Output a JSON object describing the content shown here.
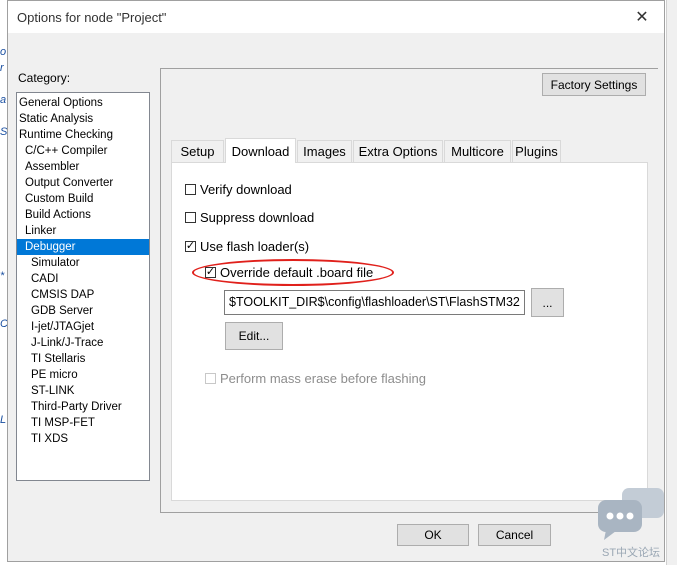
{
  "window": {
    "title": "Options for node \"Project\""
  },
  "category": {
    "label": "Category:",
    "items": [
      "General Options",
      "Static Analysis",
      "Runtime Checking",
      "C/C++ Compiler",
      "Assembler",
      "Output Converter",
      "Custom Build",
      "Build Actions",
      "Linker",
      "Debugger",
      "Simulator",
      "CADI",
      "CMSIS DAP",
      "GDB Server",
      "I-jet/JTAGjet",
      "J-Link/J-Trace",
      "TI Stellaris",
      "PE micro",
      "ST-LINK",
      "Third-Party Driver",
      "TI MSP-FET",
      "TI XDS"
    ],
    "selected": "Debugger"
  },
  "factory_settings_label": "Factory Settings",
  "tabs": [
    "Setup",
    "Download",
    "Images",
    "Extra Options",
    "Multicore",
    "Plugins"
  ],
  "active_tab": "Download",
  "download": {
    "verify": {
      "label": "Verify download",
      "checked": false
    },
    "suppress": {
      "label": "Suppress download",
      "checked": false
    },
    "flash_loader": {
      "label": "Use flash loader(s)",
      "checked": true
    },
    "override_board": {
      "label": "Override default .board file",
      "checked": true
    },
    "board_path": "$TOOLKIT_DIR$\\config\\flashloader\\ST\\FlashSTM32",
    "browse_label": "...",
    "edit_label": "Edit...",
    "mass_erase": {
      "label": "Perform mass erase before flashing",
      "checked": false,
      "enabled": false
    }
  },
  "buttons": {
    "ok": "OK",
    "cancel": "Cancel"
  },
  "watermark": {
    "text": "ST中文论坛"
  },
  "colors": {
    "selection": "#0078d7",
    "highlight": "#e0201b"
  }
}
